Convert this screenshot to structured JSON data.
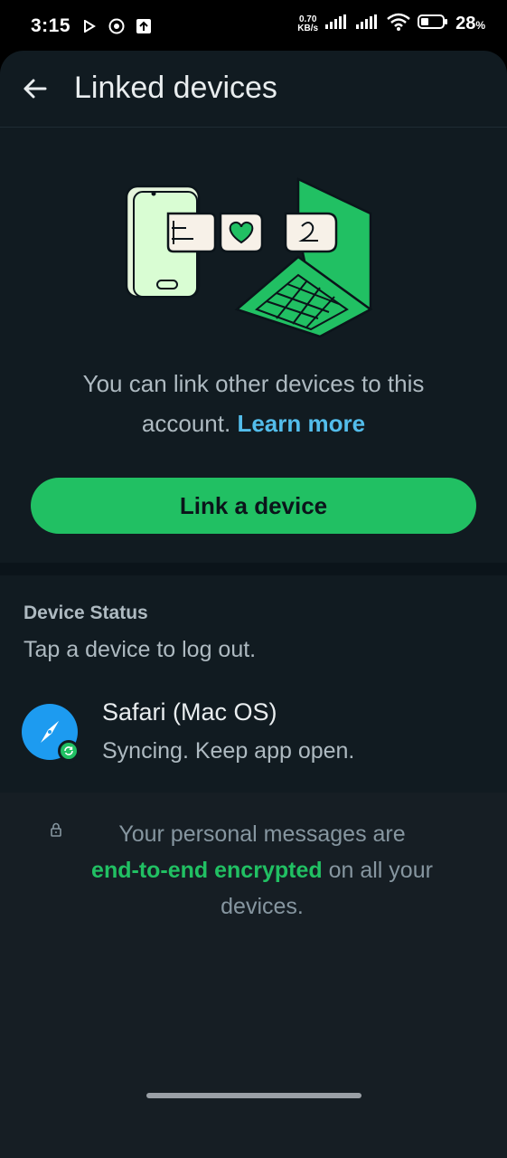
{
  "status_bar": {
    "time": "3:15",
    "speed_value": "0.70",
    "speed_unit": "KB/s",
    "battery": "28",
    "battery_unit": "%"
  },
  "header": {
    "title": "Linked devices",
    "back_icon": "arrow-left-icon"
  },
  "intro": {
    "text": "You can link other devices to this account.",
    "link_text": "Learn more"
  },
  "link_button": {
    "label": "Link a device"
  },
  "device_status": {
    "title": "Device Status",
    "subtitle": "Tap a device to log out.",
    "devices": [
      {
        "name": "Safari (Mac OS)",
        "status": "Syncing. Keep app open.",
        "icon": "safari-compass-icon"
      }
    ]
  },
  "encryption": {
    "prefix": "Your personal messages are",
    "highlight": "end-to-end encrypted",
    "suffix": "on all your devices."
  },
  "colors": {
    "accent": "#21c063",
    "link": "#53bdeb",
    "background": "#111b21"
  }
}
